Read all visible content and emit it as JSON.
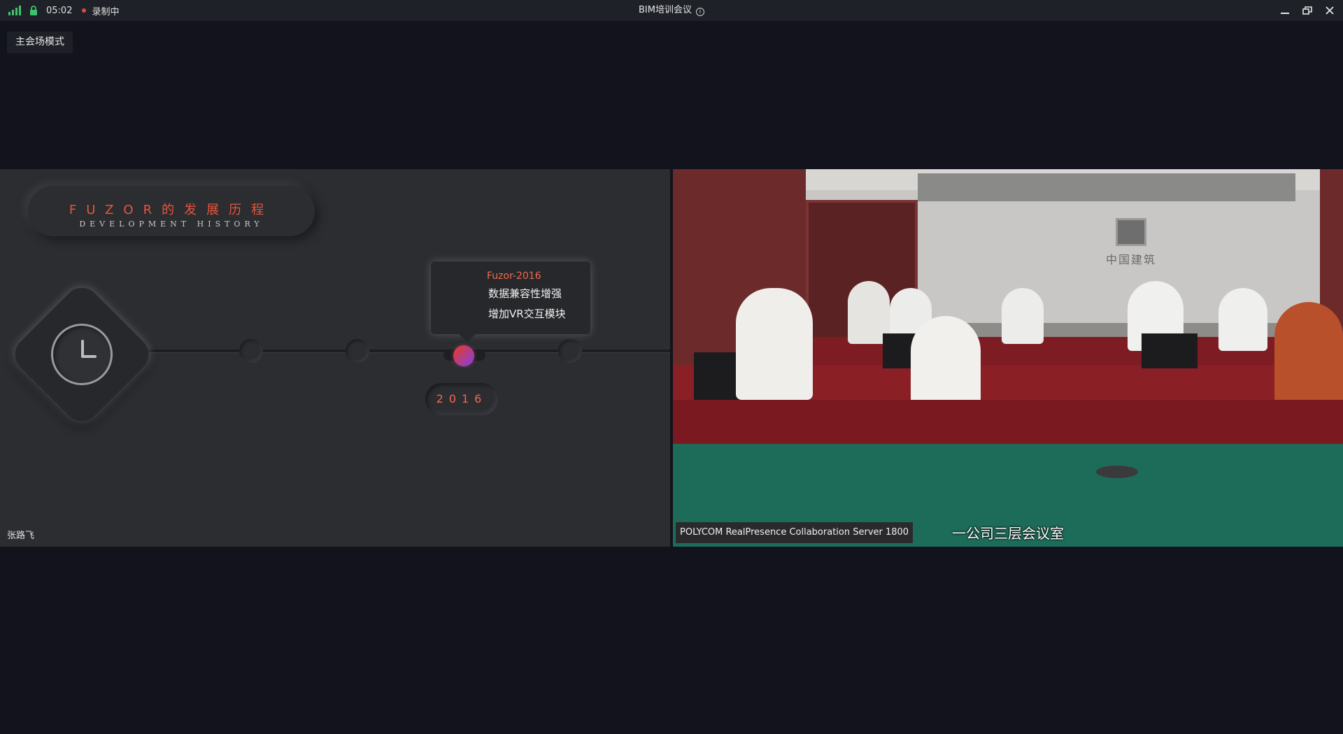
{
  "titlebar": {
    "time": "05:02",
    "recording": "录制中",
    "title": "BIM培训会议",
    "info_glyph": "i",
    "icons": {
      "signal": "signal-icon",
      "lock": "lock-icon",
      "info": "info-icon",
      "minimize": "minimize-icon",
      "restore": "restore-icon",
      "close": "close-icon"
    },
    "colors": {
      "signal": "#3cc46a",
      "lock": "#3cc46a",
      "rec": "#e04848"
    }
  },
  "mode_badge": "主会场模式",
  "slide": {
    "title_cn": "FUZOR的发展历程",
    "title_en": "DEVELOPMENT HISTORY",
    "tooltip": {
      "title": "Fuzor-2016",
      "lines": [
        "数据兼容性增强",
        "增加VR交互模块"
      ]
    },
    "year": "2016",
    "presenter": "张路飞",
    "accent": "#f06a4e"
  },
  "video": {
    "source_label": "POLYCOM RealPresence Collaboration Server 1800",
    "room_name": "一公司三层会议室",
    "wall_logo": "中国建筑"
  }
}
